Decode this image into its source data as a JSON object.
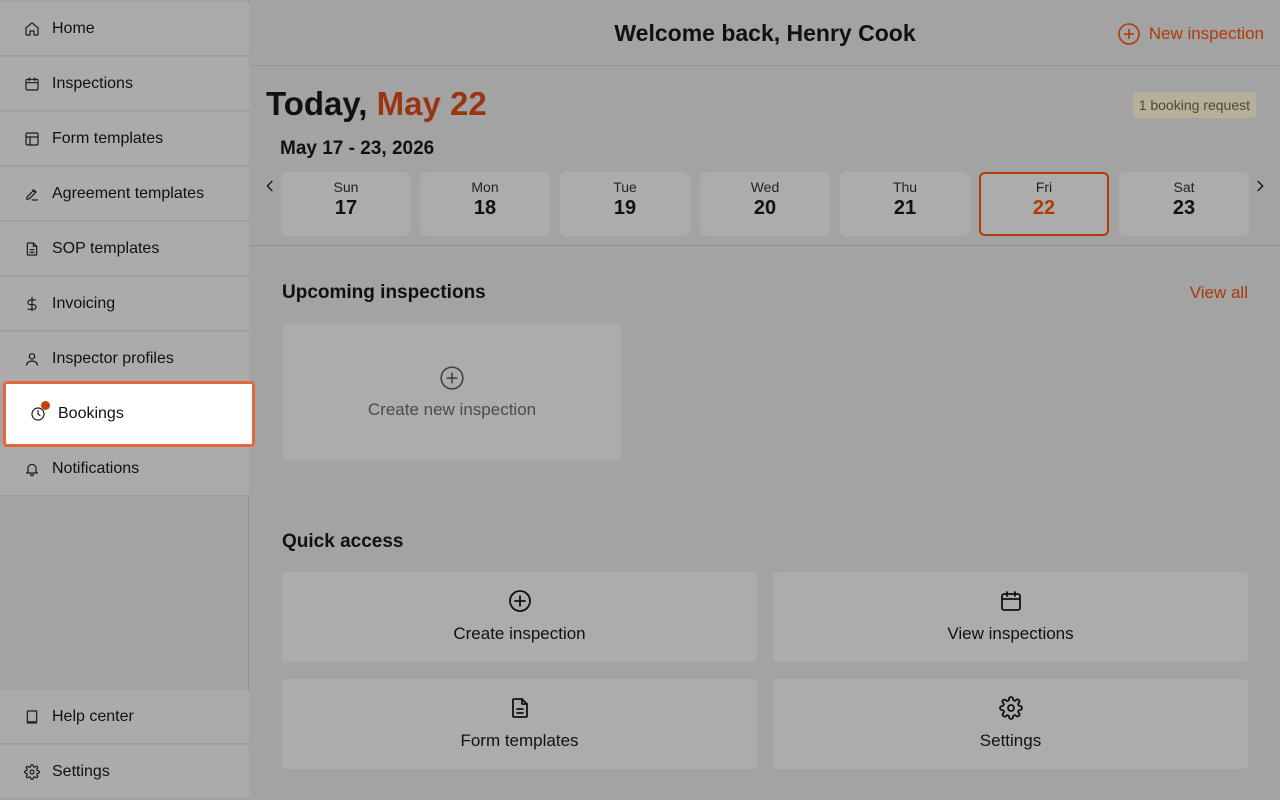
{
  "header": {
    "welcome": "Welcome back, Henry Cook",
    "new_inspection_label": "New inspection"
  },
  "sidebar": {
    "items": [
      {
        "label": "Home",
        "icon": "home-icon"
      },
      {
        "label": "Inspections",
        "icon": "calendar-icon"
      },
      {
        "label": "Form templates",
        "icon": "layout-icon"
      },
      {
        "label": "Agreement templates",
        "icon": "signature-icon"
      },
      {
        "label": "SOP templates",
        "icon": "document-icon"
      },
      {
        "label": "Invoicing",
        "icon": "dollar-icon"
      },
      {
        "label": "Inspector profiles",
        "icon": "user-icon"
      },
      {
        "label": "Bookings",
        "icon": "clock-icon"
      },
      {
        "label": "Notifications",
        "icon": "bell-icon"
      }
    ],
    "bottom_items": [
      {
        "label": "Help center",
        "icon": "book-icon"
      },
      {
        "label": "Settings",
        "icon": "gear-icon"
      }
    ]
  },
  "date": {
    "today_prefix": "Today,",
    "today_date": "May 22",
    "booking_request": "1 booking request",
    "range": "May 17 - 23, 2026",
    "days": [
      {
        "name": "Sun",
        "num": "17"
      },
      {
        "name": "Mon",
        "num": "18"
      },
      {
        "name": "Tue",
        "num": "19"
      },
      {
        "name": "Wed",
        "num": "20"
      },
      {
        "name": "Thu",
        "num": "21"
      },
      {
        "name": "Fri",
        "num": "22"
      },
      {
        "name": "Sat",
        "num": "23"
      }
    ]
  },
  "upcoming": {
    "title": "Upcoming inspections",
    "view_all": "View all",
    "create_new": "Create new inspection"
  },
  "quick_access": {
    "title": "Quick access",
    "items": [
      {
        "label": "Create inspection",
        "icon": "plus-circle-icon"
      },
      {
        "label": "View inspections",
        "icon": "calendar-icon"
      },
      {
        "label": "Form templates",
        "icon": "document-icon"
      },
      {
        "label": "Settings",
        "icon": "gear-icon"
      }
    ]
  },
  "colors": {
    "accent": "#b13a05",
    "highlight_border": "#e4673f",
    "notification_dot": "#c2410c"
  }
}
